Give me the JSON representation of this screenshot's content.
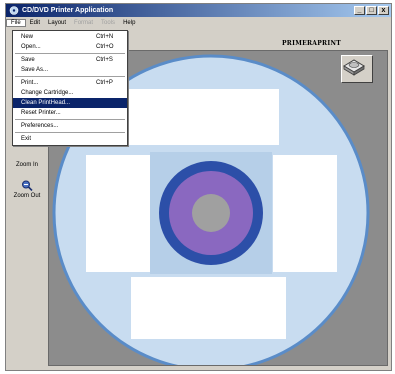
{
  "window": {
    "title": "CD/DVD Printer Application",
    "buttons": [
      "_",
      "□",
      "x"
    ]
  },
  "menubar": {
    "items": [
      {
        "label": "File",
        "state": "active"
      },
      {
        "label": "Edit",
        "state": "normal"
      },
      {
        "label": "Layout",
        "state": "normal"
      },
      {
        "label": "Format",
        "state": "disabled"
      },
      {
        "label": "Tools",
        "state": "disabled"
      },
      {
        "label": "Help",
        "state": "normal"
      }
    ]
  },
  "brand": "PRIMERAPRINT",
  "file_menu": {
    "new": {
      "label": "New",
      "shortcut": "Ctrl+N"
    },
    "open": {
      "label": "Open...",
      "shortcut": "Ctrl+O"
    },
    "save": {
      "label": "Save",
      "shortcut": "Ctrl+S"
    },
    "save_as": {
      "label": "Save As..."
    },
    "print": {
      "label": "Print...",
      "shortcut": "Ctrl+P"
    },
    "change_cartridge": {
      "label": "Change Cartridge..."
    },
    "clean_printhead": {
      "label": "Clean PrintHead..."
    },
    "reset_printer": {
      "label": "Reset Printer..."
    },
    "preferences": {
      "label": "Preferences..."
    },
    "exit": {
      "label": "Exit"
    }
  },
  "toolbar": {
    "zoom_in_label": "Zoom In",
    "zoom_out_label": "Zoom Out"
  },
  "colors": {
    "titlebar_start": "#0a246a",
    "disc_fill": "#c8dcf0",
    "disc_edge": "#5a8cc8",
    "hub_ring": "#2c4fa8",
    "hub_inner": "#8a68c0",
    "hole": "#a0a0a0"
  }
}
